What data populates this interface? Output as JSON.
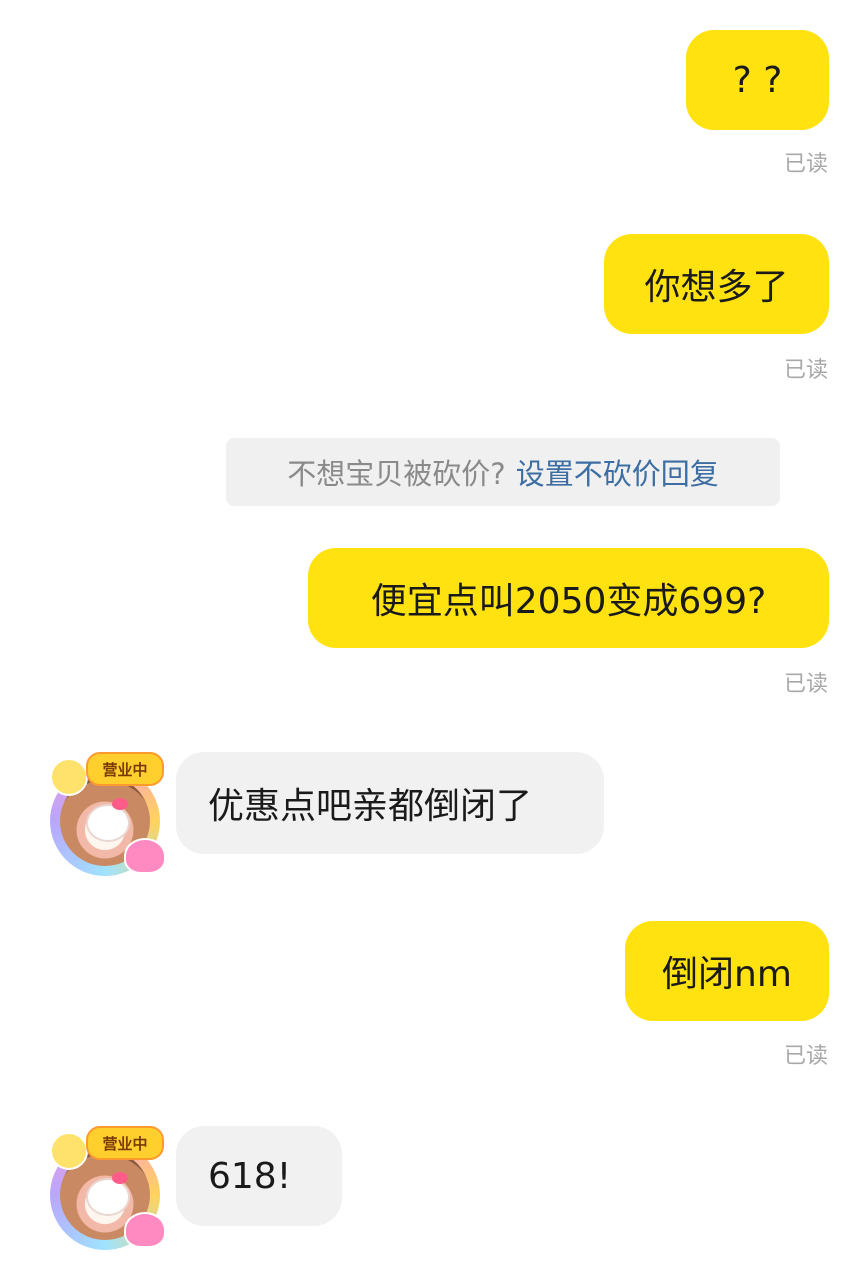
{
  "read_label": "已读",
  "system_tip": {
    "question": "不想宝贝被砍价?",
    "link": "设置不砍价回复"
  },
  "avatar": {
    "badge": "营业中"
  },
  "messages": [
    {
      "text": "? ?"
    },
    {
      "text": "你想多了"
    },
    {
      "text": "便宜点叫2050变成699?"
    },
    {
      "text": "优惠点吧亲都倒闭了"
    },
    {
      "text": "倒闭nm"
    },
    {
      "text": "618!"
    }
  ]
}
